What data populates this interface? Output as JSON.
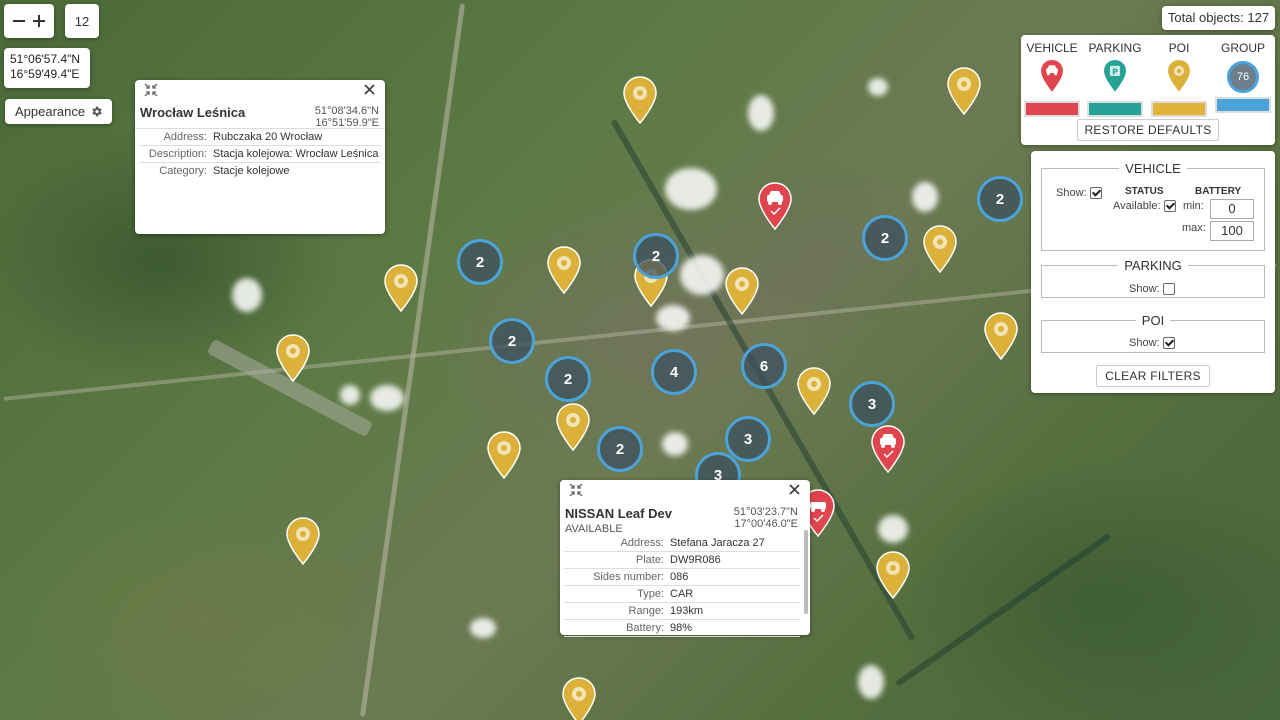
{
  "map": {
    "zoom": "12",
    "coordinates": {
      "lat": "51°06'57.4\"N",
      "lon": "16°59'49.4\"E"
    }
  },
  "controls": {
    "zoom_out_icon": "minus-icon",
    "zoom_in_icon": "plus-icon",
    "appearance_label": "Appearance",
    "appearance_icon": "gear-icon"
  },
  "total": {
    "label": "Total objects: 127"
  },
  "legend": {
    "columns": [
      {
        "label": "VEHICLE",
        "icon": "car-icon",
        "color": "#e0444c"
      },
      {
        "label": "PARKING",
        "icon": "parking-icon",
        "color": "#26a297"
      },
      {
        "label": "POI",
        "icon": "poi-icon",
        "color": "#e0b43a"
      },
      {
        "label": "GROUP",
        "badge": "76",
        "color": "#4aa3d9"
      }
    ],
    "restore_label": "RESTORE DEFAULTS"
  },
  "filters": {
    "vehicle": {
      "title": "VEHICLE",
      "show_label": "Show:",
      "show_checked": true,
      "status_title": "STATUS",
      "available_label": "Available:",
      "available_checked": true,
      "battery_title": "BATTERY",
      "min_label": "min:",
      "min_value": "0",
      "max_label": "max:",
      "max_value": "100"
    },
    "parking": {
      "title": "PARKING",
      "show_label": "Show:",
      "show_checked": false
    },
    "poi": {
      "title": "POI",
      "show_label": "Show:",
      "show_checked": true
    },
    "clear_label": "CLEAR FILTERS"
  },
  "popup_poi": {
    "title": "Wrocław Leśnica",
    "lat": "51°08'34.6\"N",
    "lon": "16°51'59.9\"E",
    "rows": [
      {
        "k": "Address:",
        "v": "Rubczaka 20 Wrocław"
      },
      {
        "k": "Description:",
        "v": "Stacja kolejowa: Wrocław Leśnica"
      },
      {
        "k": "Category:",
        "v": "Stacje kolejowe"
      }
    ]
  },
  "popup_vehicle": {
    "title": "NISSAN Leaf Dev",
    "status": "AVAILABLE",
    "lat": "51°03'23.7\"N",
    "lon": "17°00'46.0\"E",
    "rows": [
      {
        "k": "Address:",
        "v": "Stefana Jaracza 27"
      },
      {
        "k": "Plate:",
        "v": "DW9R086"
      },
      {
        "k": "Sides number:",
        "v": "086"
      },
      {
        "k": "Type:",
        "v": "CAR"
      },
      {
        "k": "Range:",
        "v": "193km"
      },
      {
        "k": "Battery:",
        "v": "98%"
      }
    ]
  },
  "clusters": [
    "2",
    "2",
    "2",
    "2",
    "2",
    "2",
    "2",
    "4",
    "6",
    "3",
    "3",
    "3",
    "2"
  ]
}
